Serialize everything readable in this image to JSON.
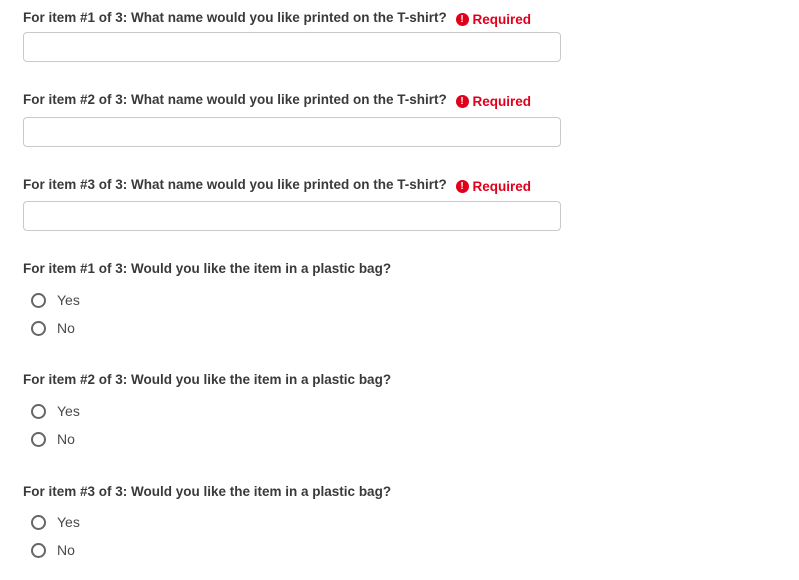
{
  "name_questions": [
    {
      "label": "For item #1 of 3: What name would you like printed on the T-shirt?",
      "required_label": "Required",
      "value": "",
      "placeholder": ""
    },
    {
      "label": "For item #2 of 3: What name would you like printed on the T-shirt?",
      "required_label": "Required",
      "value": "",
      "placeholder": ""
    },
    {
      "label": "For item #3 of 3: What name would you like printed on the T-shirt?",
      "required_label": "Required",
      "value": "",
      "placeholder": ""
    }
  ],
  "required_icon": {
    "glyph": "!",
    "name": "exclamation-circle-icon",
    "color": "#e0001b"
  },
  "bag_questions": [
    {
      "label": "For item #1 of 3: Would you like the item in a plastic bag?",
      "options": [
        "Yes",
        "No"
      ],
      "selected": null
    },
    {
      "label": "For item #2 of 3: Would you like the item in a plastic bag?",
      "options": [
        "Yes",
        "No"
      ],
      "selected": null
    },
    {
      "label": "For item #3 of 3: Would you like the item in a plastic bag?",
      "options": [
        "Yes",
        "No"
      ],
      "selected": null
    }
  ]
}
